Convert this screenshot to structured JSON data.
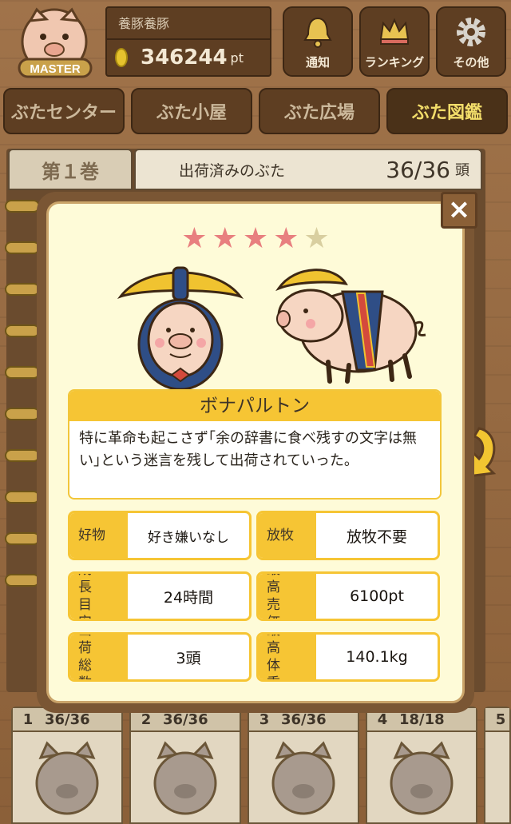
{
  "header": {
    "user_name": "養豚養豚",
    "points_value": "346244",
    "points_unit": "pt",
    "badge_text": "MASTER",
    "buttons": [
      {
        "label": "通知",
        "icon": "bell-icon"
      },
      {
        "label": "ランキング",
        "icon": "crown-icon"
      },
      {
        "label": "その他",
        "icon": "gear-icon"
      }
    ]
  },
  "tabs": [
    {
      "label": "ぶたセンター",
      "active": false
    },
    {
      "label": "ぶた小屋",
      "active": false
    },
    {
      "label": "ぶた広場",
      "active": false
    },
    {
      "label": "ぶた図鑑",
      "active": true
    }
  ],
  "book": {
    "volume_label": "第１巻",
    "heading": "出荷済みのぶた",
    "count": "36/36",
    "count_unit": "頭"
  },
  "modal": {
    "close_label": "×",
    "rating": 4,
    "rating_max": 5,
    "stars": [
      "★",
      "★",
      "★",
      "★",
      "★"
    ],
    "pig_name": "ボナパルトン",
    "description": "特に革命も起こさず｢余の辞書に食べ残すの文字は無い｣という迷言を残して出荷されていった。",
    "stats": [
      {
        "key": "好物",
        "value": "好き嫌いなし"
      },
      {
        "key": "放牧",
        "value": "放牧不要"
      },
      {
        "key": "成長目安",
        "value": "24時間"
      },
      {
        "key": "最高売価",
        "value": "6100pt"
      },
      {
        "key": "出荷総数",
        "value": "3頭"
      },
      {
        "key": "最高体重",
        "value": "140.1kg"
      }
    ]
  },
  "volumes": [
    {
      "num": "1",
      "count": "36/36"
    },
    {
      "num": "2",
      "count": "36/36"
    },
    {
      "num": "3",
      "count": "36/36"
    },
    {
      "num": "4",
      "count": "18/18"
    },
    {
      "num": "5",
      "count": ""
    }
  ],
  "colors": {
    "accent_yellow": "#f6c534",
    "star_filled": "#e87f7f",
    "star_empty": "#d9cfa0",
    "wood": "#8b6039"
  }
}
